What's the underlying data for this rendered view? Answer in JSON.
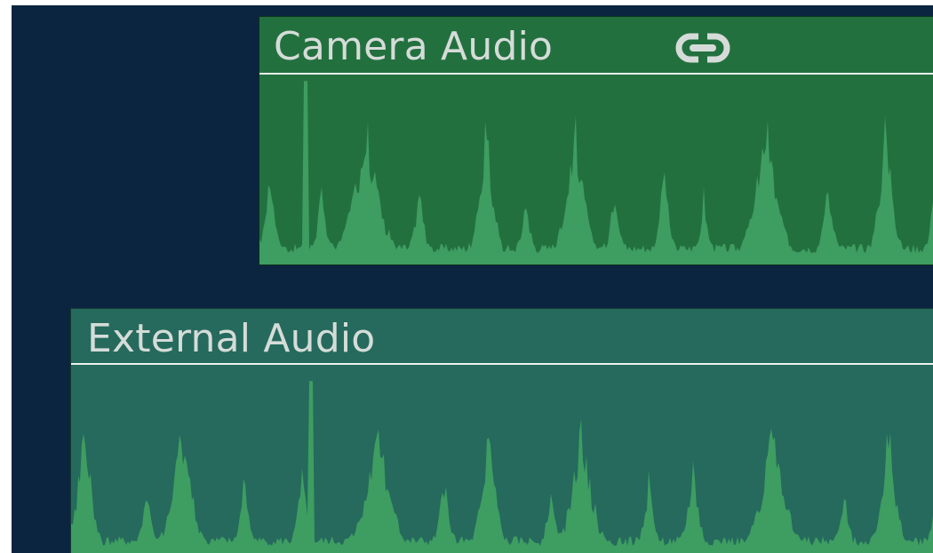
{
  "tracks": [
    {
      "title": "Camera Audio",
      "icon": "link-icon",
      "colors": {
        "background": "#23703f",
        "waveform": "#3e9d61",
        "header_line": "#eef2ef",
        "title": "#d5dcd8"
      }
    },
    {
      "title": "External Audio",
      "colors": {
        "background": "#256a5d",
        "waveform": "#3e9d61",
        "header_line": "#eef2ef",
        "title": "#d5dcd8"
      }
    }
  ],
  "colors": {
    "timeline_background": "#0b2540"
  }
}
